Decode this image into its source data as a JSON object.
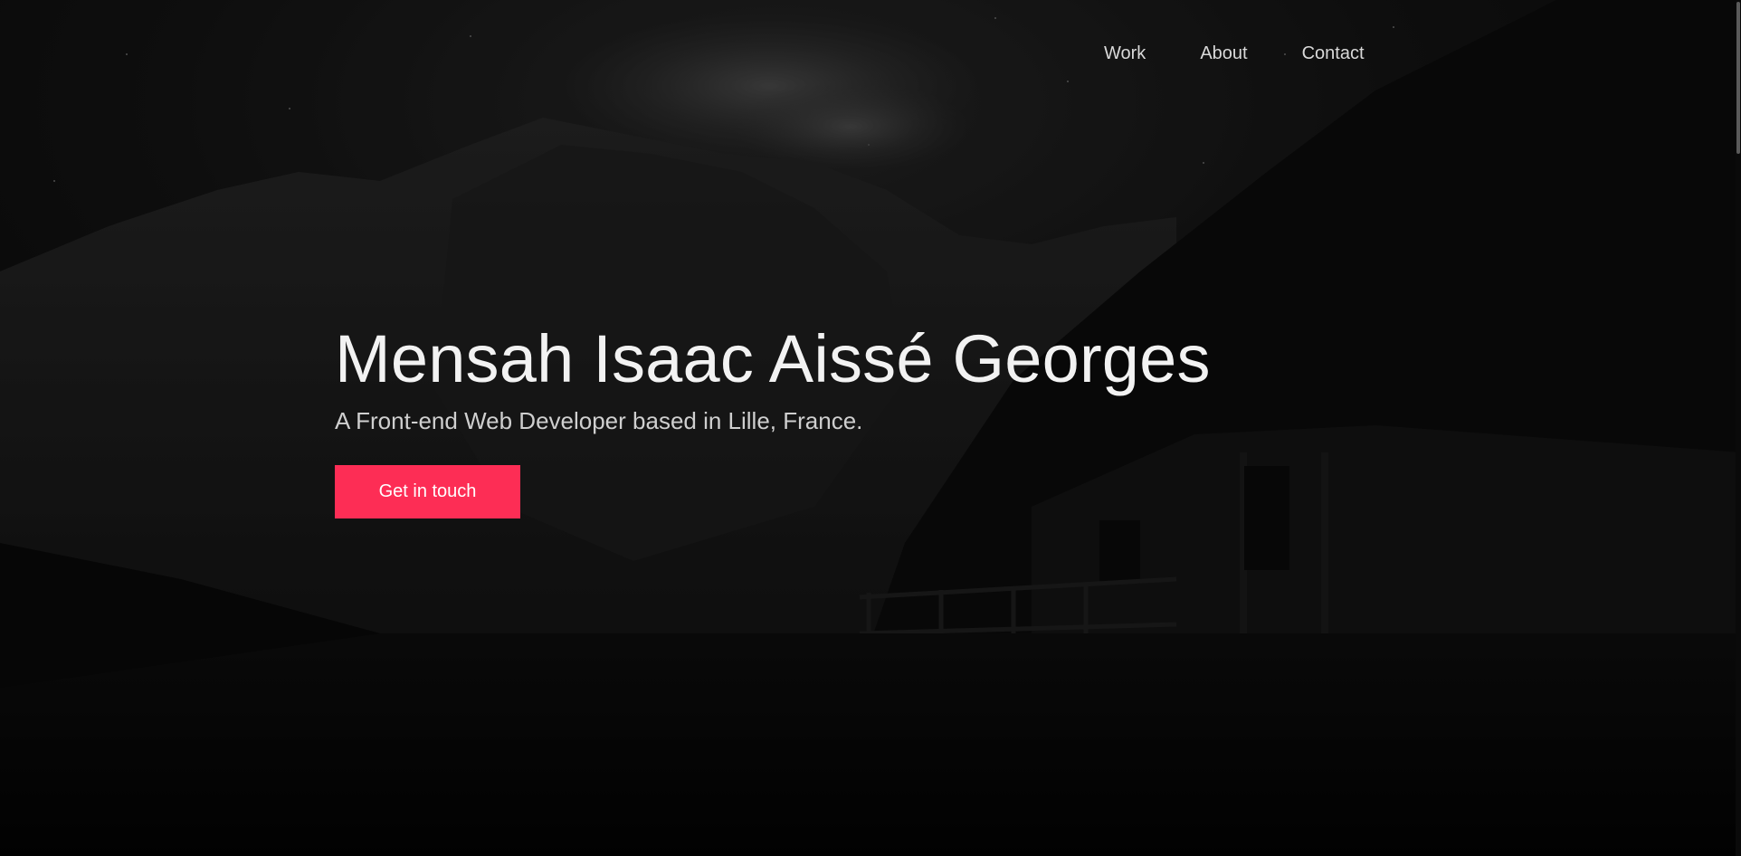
{
  "nav": {
    "items": [
      {
        "label": "Work"
      },
      {
        "label": "About"
      },
      {
        "label": "Contact"
      }
    ]
  },
  "hero": {
    "title": "Mensah Isaac Aissé Georges",
    "subtitle": "A Front-end Web Developer based in Lille, France.",
    "cta_label": "Get in touch"
  },
  "colors": {
    "accent": "#fd2d55",
    "background": "#060606",
    "title_text": "#f2f2f2",
    "nav_text": "#d9d9d9"
  }
}
